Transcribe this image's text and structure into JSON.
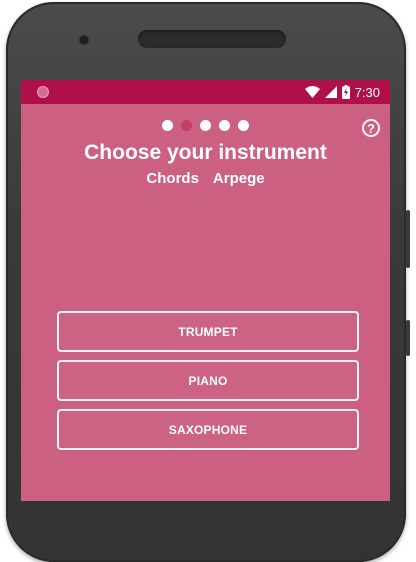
{
  "status_bar": {
    "time": "7:30",
    "icons": [
      "circle-app-icon",
      "wifi-icon",
      "signal-icon",
      "battery-charging-icon"
    ]
  },
  "onboarding": {
    "pager_dots": [
      {
        "state": "inactive"
      },
      {
        "state": "active"
      },
      {
        "state": "inactive"
      },
      {
        "state": "inactive"
      },
      {
        "state": "inactive"
      }
    ],
    "title": "Choose your instrument",
    "modes": [
      "Chords",
      "Arpege"
    ],
    "help_icon": "help-circle-icon"
  },
  "instruments": [
    {
      "label": "TRUMPET"
    },
    {
      "label": "PIANO"
    },
    {
      "label": "SAXOPHONE"
    }
  ],
  "colors": {
    "screen_background": "#cc6080",
    "status_bar": "#b0104a",
    "active_dot": "#c0406b",
    "text": "#ffffff"
  }
}
